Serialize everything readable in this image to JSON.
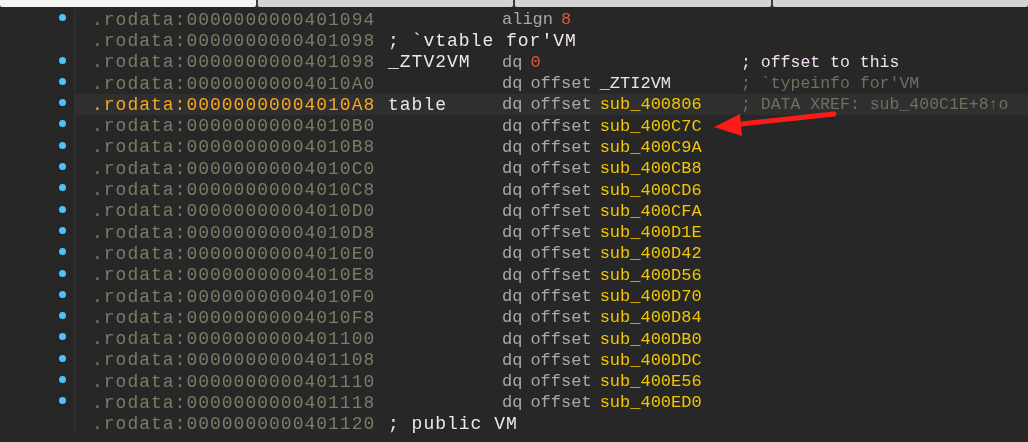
{
  "tabs": [
    {
      "selected": true
    },
    {
      "selected": false
    },
    {
      "selected": false
    },
    {
      "selected": false
    }
  ],
  "rows": [
    {
      "dot": true,
      "selected": false,
      "address": ".rodata:0000000000401094",
      "mnemonic": "align",
      "operand": {
        "text": "8",
        "kind": "number"
      }
    },
    {
      "dot": false,
      "selected": false,
      "address": ".rodata:0000000000401098",
      "label": {
        "text": "; `vtable for'VM",
        "kind": "comment"
      }
    },
    {
      "dot": true,
      "selected": false,
      "address": ".rodata:0000000000401098",
      "label": {
        "text": "_ZTV2VM",
        "kind": "name"
      },
      "mnemonic": "dq",
      "operand": {
        "text": "0",
        "kind": "number"
      },
      "comment": {
        "text": "; offset to this",
        "kind": "regular"
      }
    },
    {
      "dot": true,
      "selected": false,
      "address": ".rodata:00000000004010A0",
      "mnemonic": "dq",
      "prefix": "offset",
      "operand": {
        "text": "_ZTI2VM",
        "kind": "data"
      },
      "comment": {
        "text": "; `typeinfo for'VM",
        "kind": "auto"
      }
    },
    {
      "dot": true,
      "selected": true,
      "address": ".rodata:00000000004010A8",
      "label": {
        "text": "table",
        "kind": "name"
      },
      "mnemonic": "dq",
      "prefix": "offset",
      "operand": {
        "text": "sub_400806",
        "kind": "code"
      },
      "comment": {
        "text": "; DATA XREF: sub_400C1E+8↑o",
        "kind": "auto"
      }
    },
    {
      "dot": true,
      "selected": false,
      "address": ".rodata:00000000004010B0",
      "mnemonic": "dq",
      "prefix": "offset",
      "operand": {
        "text": "sub_400C7C",
        "kind": "code"
      }
    },
    {
      "dot": true,
      "selected": false,
      "address": ".rodata:00000000004010B8",
      "mnemonic": "dq",
      "prefix": "offset",
      "operand": {
        "text": "sub_400C9A",
        "kind": "code"
      }
    },
    {
      "dot": true,
      "selected": false,
      "address": ".rodata:00000000004010C0",
      "mnemonic": "dq",
      "prefix": "offset",
      "operand": {
        "text": "sub_400CB8",
        "kind": "code"
      }
    },
    {
      "dot": true,
      "selected": false,
      "address": ".rodata:00000000004010C8",
      "mnemonic": "dq",
      "prefix": "offset",
      "operand": {
        "text": "sub_400CD6",
        "kind": "code"
      }
    },
    {
      "dot": true,
      "selected": false,
      "address": ".rodata:00000000004010D0",
      "mnemonic": "dq",
      "prefix": "offset",
      "operand": {
        "text": "sub_400CFA",
        "kind": "code"
      }
    },
    {
      "dot": true,
      "selected": false,
      "address": ".rodata:00000000004010D8",
      "mnemonic": "dq",
      "prefix": "offset",
      "operand": {
        "text": "sub_400D1E",
        "kind": "code"
      }
    },
    {
      "dot": true,
      "selected": false,
      "address": ".rodata:00000000004010E0",
      "mnemonic": "dq",
      "prefix": "offset",
      "operand": {
        "text": "sub_400D42",
        "kind": "code"
      }
    },
    {
      "dot": true,
      "selected": false,
      "address": ".rodata:00000000004010E8",
      "mnemonic": "dq",
      "prefix": "offset",
      "operand": {
        "text": "sub_400D56",
        "kind": "code"
      }
    },
    {
      "dot": true,
      "selected": false,
      "address": ".rodata:00000000004010F0",
      "mnemonic": "dq",
      "prefix": "offset",
      "operand": {
        "text": "sub_400D70",
        "kind": "code"
      }
    },
    {
      "dot": true,
      "selected": false,
      "address": ".rodata:00000000004010F8",
      "mnemonic": "dq",
      "prefix": "offset",
      "operand": {
        "text": "sub_400D84",
        "kind": "code"
      }
    },
    {
      "dot": true,
      "selected": false,
      "address": ".rodata:0000000000401100",
      "mnemonic": "dq",
      "prefix": "offset",
      "operand": {
        "text": "sub_400DB0",
        "kind": "code"
      }
    },
    {
      "dot": true,
      "selected": false,
      "address": ".rodata:0000000000401108",
      "mnemonic": "dq",
      "prefix": "offset",
      "operand": {
        "text": "sub_400DDC",
        "kind": "code"
      }
    },
    {
      "dot": true,
      "selected": false,
      "address": ".rodata:0000000000401110",
      "mnemonic": "dq",
      "prefix": "offset",
      "operand": {
        "text": "sub_400E56",
        "kind": "code"
      }
    },
    {
      "dot": true,
      "selected": false,
      "address": ".rodata:0000000000401118",
      "mnemonic": "dq",
      "prefix": "offset",
      "operand": {
        "text": "sub_400ED0",
        "kind": "code"
      }
    },
    {
      "dot": false,
      "selected": false,
      "address": ".rodata:0000000000401120",
      "label": {
        "text": "; public VM",
        "kind": "comment"
      }
    }
  ]
}
